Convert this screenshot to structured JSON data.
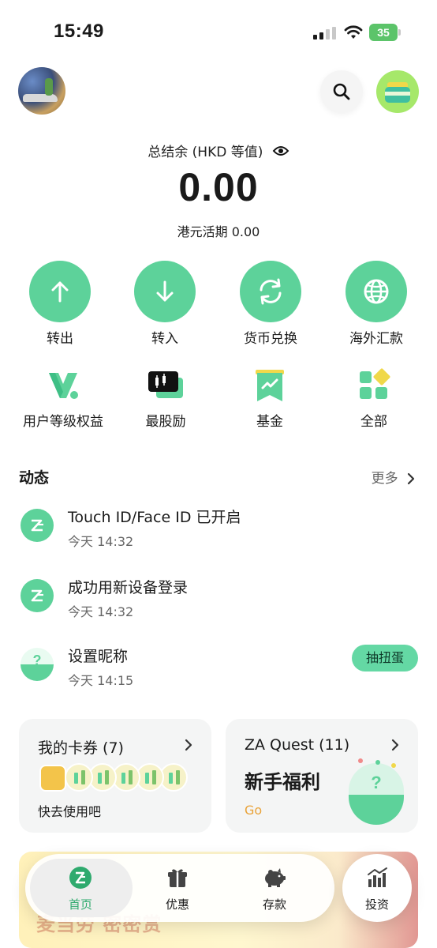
{
  "status_bar": {
    "time": "15:49",
    "battery": "35"
  },
  "header": {
    "avatar": "avatar",
    "search_icon": "search-icon",
    "wallet_icon": "wallet-icon"
  },
  "balance": {
    "label": "总结余 (HKD 等值)",
    "value": "0.00",
    "hkd_current": "港元活期 0.00"
  },
  "primary_actions": [
    {
      "label": "转出",
      "icon": "arrow-up-icon"
    },
    {
      "label": "转入",
      "icon": "arrow-down-icon"
    },
    {
      "label": "货币兑换",
      "icon": "exchange-icon"
    },
    {
      "label": "海外汇款",
      "icon": "globe-icon"
    }
  ],
  "secondary_actions": [
    {
      "label": "用户等级权益",
      "icon": "tier-icon"
    },
    {
      "label": "最股励",
      "icon": "stock-card-icon"
    },
    {
      "label": "基金",
      "icon": "fund-icon"
    },
    {
      "label": "全部",
      "icon": "grid-icon"
    }
  ],
  "activity": {
    "title": "动态",
    "more": "更多",
    "items": [
      {
        "title": "Touch ID/Face ID 已开启",
        "time": "今天 14:32"
      },
      {
        "title": "成功用新设备登录",
        "time": "今天 14:32"
      },
      {
        "title": "设置昵称",
        "time": "今天 14:15",
        "action": "抽扭蛋"
      }
    ]
  },
  "cards": {
    "coupons": {
      "title": "我的卡券 (7)",
      "subtitle": "快去使用吧"
    },
    "quest": {
      "title": "ZA Quest (11)",
      "headline": "新手福利",
      "cta": "Go"
    }
  },
  "banner": {
    "text": "麦当劳 密密赏"
  },
  "tabbar": {
    "tabs": [
      {
        "label": "首页",
        "icon": "home-icon",
        "active": true
      },
      {
        "label": "优惠",
        "icon": "gift-icon"
      },
      {
        "label": "存款",
        "icon": "piggy-bank-icon"
      },
      {
        "label": "投资",
        "icon": "chart-icon"
      }
    ]
  },
  "colors": {
    "accent": "#5dd29a",
    "accent_dark": "#2faa6e",
    "gacha": "#64d8a4",
    "go": "#e9a33a"
  }
}
